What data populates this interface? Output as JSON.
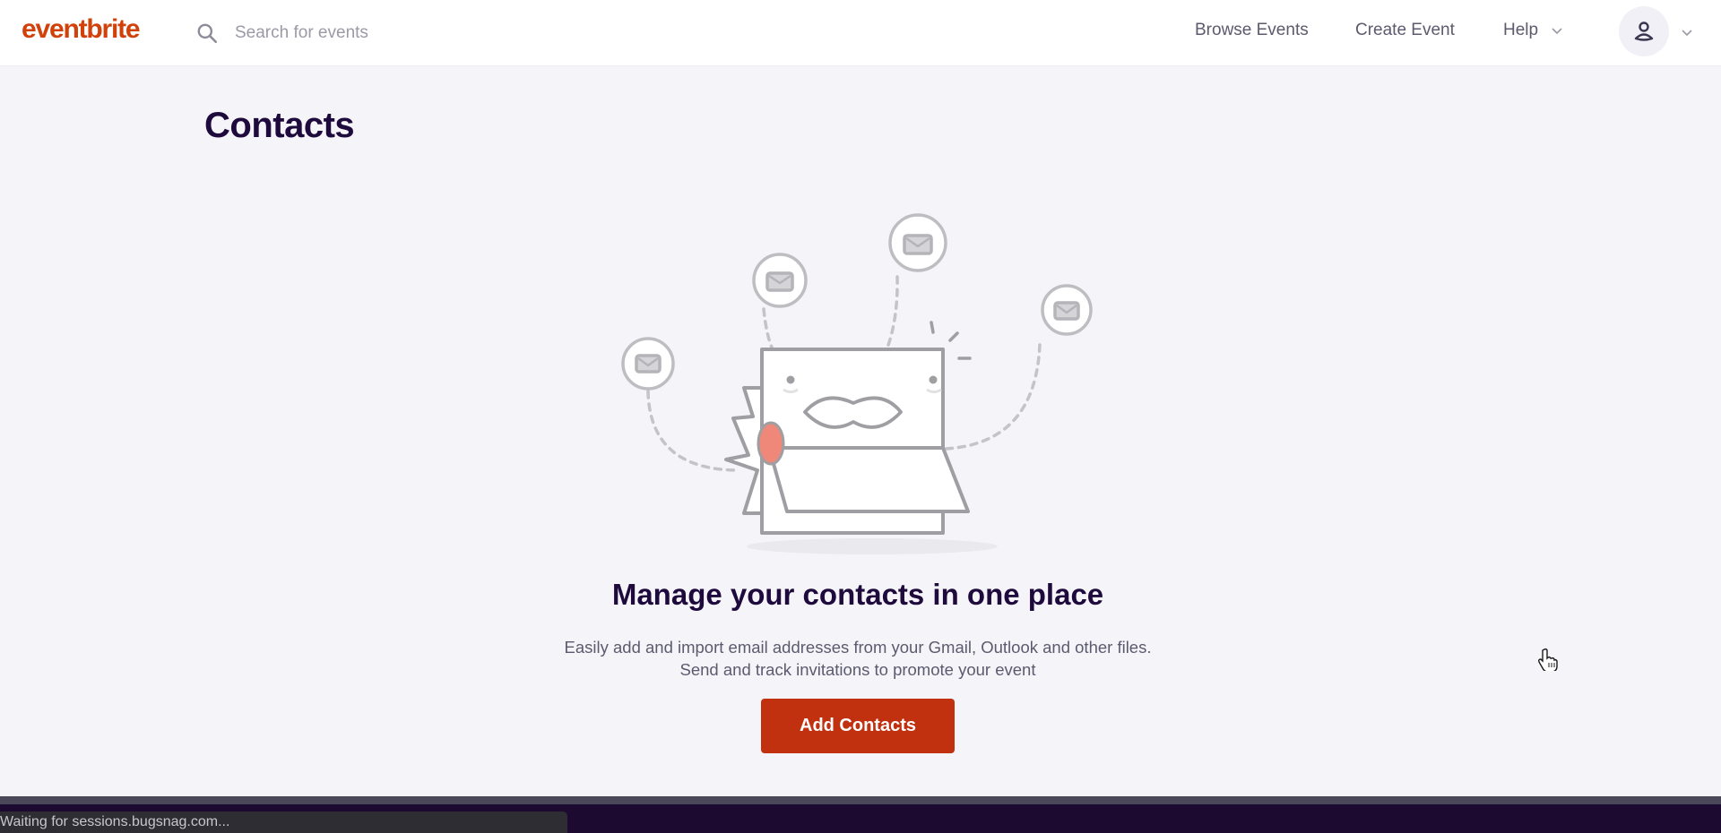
{
  "header": {
    "logo_text": "eventbrite",
    "search": {
      "placeholder": "Search for events",
      "value": "",
      "icon": "search-icon"
    },
    "nav": {
      "browse_events": "Browse Events",
      "create_event": "Create Event",
      "help": "Help"
    },
    "account_icon": "user-icon"
  },
  "main": {
    "page_title": "Contacts",
    "empty_state": {
      "illustration": "mailbox-with-mustache-and-envelopes",
      "headline": "Manage your contacts in one place",
      "description_line1": "Easily add and import email addresses from your Gmail, Outlook and other files.",
      "description_line2": "Send and track invitations to promote your event",
      "cta_label": "Add Contacts"
    }
  },
  "browser_status": "Waiting for sessions.bugsnag.com...",
  "colors": {
    "brand": "#d1410c",
    "cta": "#c1300f",
    "title": "#1e0a3c",
    "background": "#f5f5f9",
    "footer": "#1c0a30"
  }
}
